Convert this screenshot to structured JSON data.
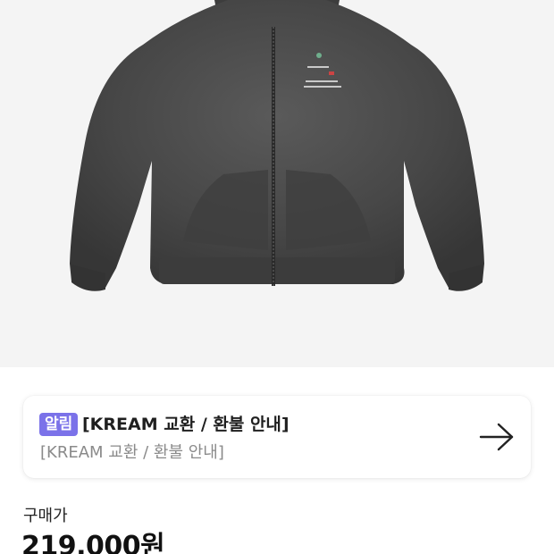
{
  "product": {
    "image_alt": "charcoal washed zip-up hoodie",
    "colors": {
      "background": "#f4f4f4",
      "garment": "#4a4a4a"
    }
  },
  "notice": {
    "badge": "알림",
    "title": "[KREAM 교환 / 환불 안내]",
    "subtitle": "[KREAM 교환 / 환불 안내]",
    "icon": "arrow-right-icon",
    "badge_color": "#7b72e9"
  },
  "price": {
    "label": "구매가",
    "value": "219,000원"
  }
}
